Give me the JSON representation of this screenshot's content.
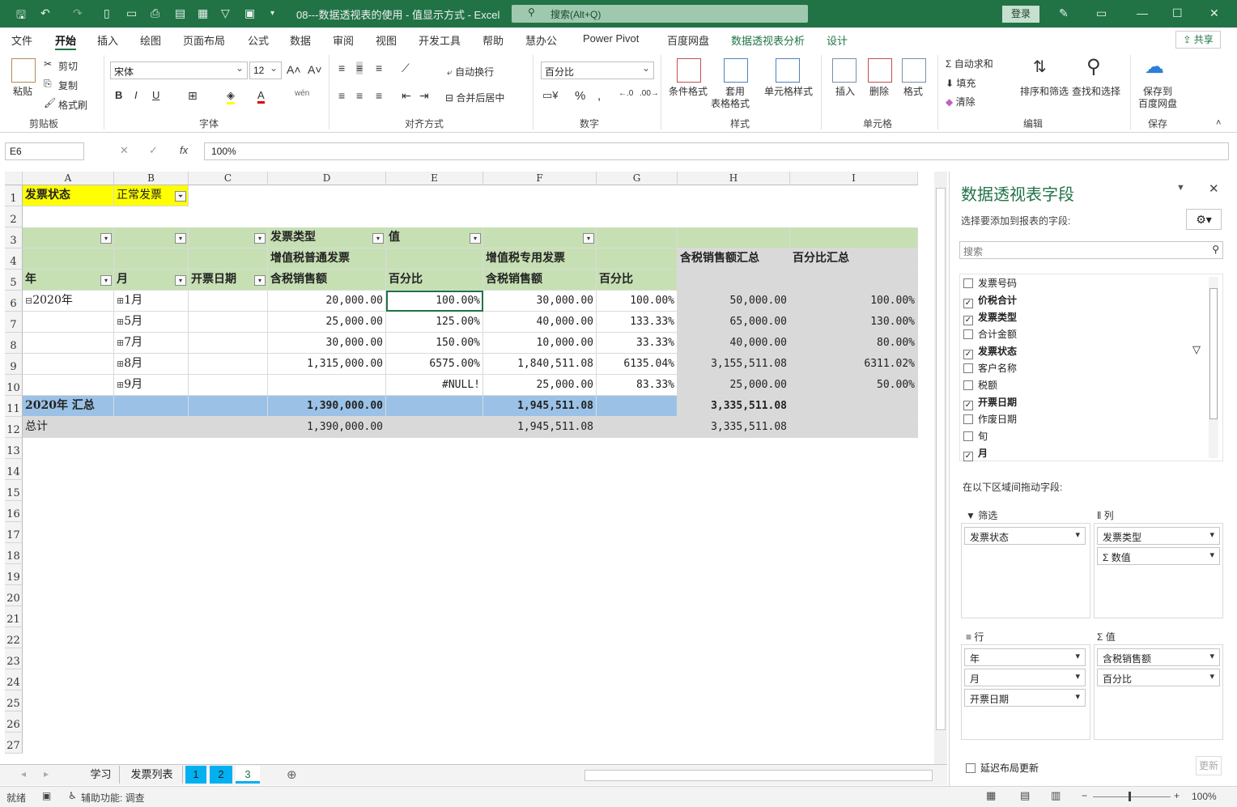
{
  "window": {
    "title": "08---数据透视表的使用 - 值显示方式 - Excel",
    "search_placeholder": "搜索(Alt+Q)",
    "login": "登录",
    "share": "共享"
  },
  "menu_tabs": [
    "文件",
    "开始",
    "插入",
    "绘图",
    "页面布局",
    "公式",
    "数据",
    "审阅",
    "视图",
    "开发工具",
    "帮助",
    "慧办公",
    "Power Pivot",
    "百度网盘",
    "数据透视表分析",
    "设计"
  ],
  "ribbon": {
    "clipboard": {
      "paste": "粘贴",
      "cut": "剪切",
      "copy": "复制",
      "format_painter": "格式刷",
      "label": "剪贴板"
    },
    "font": {
      "name": "宋体",
      "size": "12",
      "label": "字体"
    },
    "alignment": {
      "wrap": "自动换行",
      "merge": "合并后居中",
      "label": "对齐方式"
    },
    "number": {
      "format": "百分比",
      "label": "数字"
    },
    "styles": {
      "conditional": "条件格式",
      "table_1": "套用",
      "table_2": "表格格式",
      "cell_styles": "单元格样式",
      "label": "样式"
    },
    "cells": {
      "insert": "插入",
      "delete": "删除",
      "format": "格式",
      "label": "单元格"
    },
    "editing": {
      "autosum": "自动求和",
      "fill": "填充",
      "clear": "清除",
      "sort": "排序和筛选",
      "find": "查找和选择",
      "label": "编辑"
    },
    "save": {
      "save_1": "保存到",
      "save_2": "百度网盘",
      "label": "保存"
    }
  },
  "formula_bar": {
    "name_box": "E6",
    "formula": "100%"
  },
  "columns": [
    "A",
    "B",
    "C",
    "D",
    "E",
    "F",
    "G",
    "H",
    "I"
  ],
  "rows": [
    "1",
    "2",
    "3",
    "4",
    "5",
    "6",
    "7",
    "8",
    "9",
    "10",
    "11",
    "12",
    "13",
    "14",
    "15",
    "16",
    "17",
    "18",
    "19",
    "20",
    "21",
    "22",
    "23",
    "24",
    "25",
    "26",
    "27"
  ],
  "pivot": {
    "filter_label": "发票状态",
    "filter_value": "正常发票",
    "col_type_header": "发票类型",
    "values_header": "值",
    "type_normal": "增值税普通发票",
    "type_special": "增值税专用发票",
    "total_amount_header": "含税销售额汇总",
    "total_pct_header": "百分比汇总",
    "year_header": "年",
    "month_header": "月",
    "date_header": "开票日期",
    "amount_header": "含税销售额",
    "pct_header": "百分比",
    "year_2020": "2020年",
    "data_rows": [
      {
        "month": "1月",
        "d": "20,000.00",
        "e": "100.00%",
        "f": "30,000.00",
        "g": "100.00%",
        "h": "50,000.00",
        "i": "100.00%"
      },
      {
        "month": "5月",
        "d": "25,000.00",
        "e": "125.00%",
        "f": "40,000.00",
        "g": "133.33%",
        "h": "65,000.00",
        "i": "130.00%"
      },
      {
        "month": "7月",
        "d": "30,000.00",
        "e": "150.00%",
        "f": "10,000.00",
        "g": "33.33%",
        "h": "40,000.00",
        "i": "80.00%"
      },
      {
        "month": "8月",
        "d": "1,315,000.00",
        "e": "6575.00%",
        "f": "1,840,511.08",
        "g": "6135.04%",
        "h": "3,155,511.08",
        "i": "6311.02%"
      },
      {
        "month": "9月",
        "d": "",
        "e": "#NULL!",
        "f": "25,000.00",
        "g": "83.33%",
        "h": "25,000.00",
        "i": "50.00%"
      }
    ],
    "subtotal": {
      "label": "2020年 汇总",
      "d": "1,390,000.00",
      "f": "1,945,511.08",
      "h": "3,335,511.08"
    },
    "grand_total": {
      "label": "总计",
      "d": "1,390,000.00",
      "f": "1,945,511.08",
      "h": "3,335,511.08"
    }
  },
  "sheet_tabs": [
    "学习",
    "发票列表",
    "1",
    "2",
    "3"
  ],
  "status": {
    "ready": "就绪",
    "accessibility": "辅助功能: 调查",
    "zoom": "100%"
  },
  "pane": {
    "title": "数据透视表字段",
    "subtitle": "选择要添加到报表的字段:",
    "search_placeholder": "搜索",
    "fields": [
      {
        "name": "发票号码",
        "checked": false
      },
      {
        "name": "价税合计",
        "checked": true
      },
      {
        "name": "发票类型",
        "checked": true
      },
      {
        "name": "合计金额",
        "checked": false
      },
      {
        "name": "发票状态",
        "checked": true
      },
      {
        "name": "客户名称",
        "checked": false
      },
      {
        "name": "税额",
        "checked": false
      },
      {
        "name": "开票日期",
        "checked": true
      },
      {
        "name": "作废日期",
        "checked": false
      },
      {
        "name": "旬",
        "checked": false
      },
      {
        "name": "月",
        "checked": true
      }
    ],
    "drag_hint": "在以下区域间拖动字段:",
    "filters_title": "筛选",
    "columns_title": "列",
    "rows_title": "行",
    "values_title": "值",
    "filters": [
      "发票状态"
    ],
    "columns_items": [
      "发票类型",
      "数值"
    ],
    "rows_items": [
      "年",
      "月",
      "开票日期"
    ],
    "values_items": [
      "含税销售额",
      "百分比"
    ],
    "defer": "延迟布局更新",
    "update": "更新"
  },
  "colors": {
    "brand": "#217346",
    "header_green": "#c6e0b4",
    "subtotal_blue": "#9bc2e6",
    "yellow": "#ffff00",
    "gray": "#d9d9d9"
  }
}
